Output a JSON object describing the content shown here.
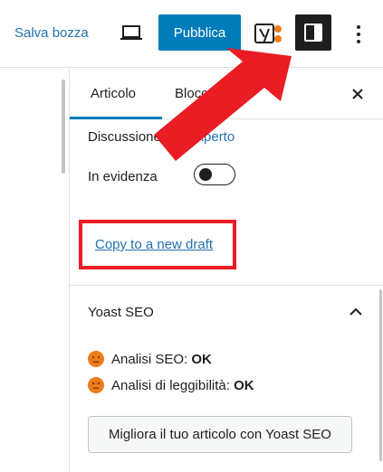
{
  "toolbar": {
    "save_draft_label": "Salva bozza",
    "publish_label": "Pubblica",
    "preview_icon": "laptop-icon",
    "yoast_icon": "yoast-icon",
    "settings_icon": "sidebar-panel-icon",
    "more_icon": "more-vertical-icon"
  },
  "sidebar": {
    "tabs": [
      {
        "label": "Articolo",
        "active": true
      },
      {
        "label": "Blocco",
        "active": false
      }
    ],
    "discussion": {
      "label": "Discussione",
      "value": "Aperto"
    },
    "featured": {
      "label": "In evidenza",
      "on": false
    },
    "copy_link": "Copy to a new draft",
    "yoast": {
      "title": "Yoast SEO",
      "seo_label": "Analisi SEO:",
      "seo_value": "OK",
      "readability_label": "Analisi di leggibilità:",
      "readability_value": "OK",
      "improve_label": "Migliora il tuo articolo con Yoast SEO"
    }
  },
  "colors": {
    "accent": "#007cba",
    "link": "#2271b1",
    "annotation_red": "#ea1c24",
    "score_orange": "#ee7c1b"
  }
}
